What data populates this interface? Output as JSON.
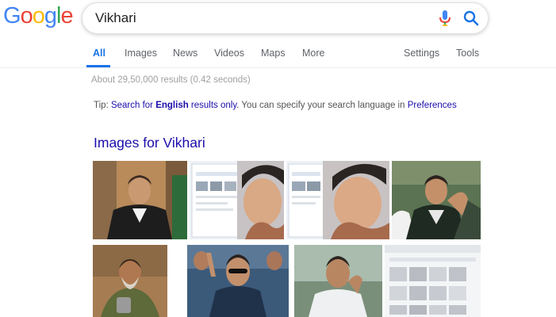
{
  "logo": {
    "letters": [
      {
        "char": "G",
        "color": "#4285F4"
      },
      {
        "char": "o",
        "color": "#EA4335"
      },
      {
        "char": "o",
        "color": "#FBBC05"
      },
      {
        "char": "g",
        "color": "#4285F4"
      },
      {
        "char": "l",
        "color": "#34A853"
      },
      {
        "char": "e",
        "color": "#EA4335"
      }
    ]
  },
  "search": {
    "query": "Vikhari",
    "mic_icon": "mic-icon",
    "search_icon": "search-icon"
  },
  "tabs": {
    "items": [
      "All",
      "Images",
      "News",
      "Videos",
      "Maps",
      "More"
    ],
    "right": [
      "Settings",
      "Tools"
    ],
    "active": "All"
  },
  "results": {
    "stats": "About 29,50,000 results (0.42 seconds)"
  },
  "tip": {
    "prefix": "Tip: ",
    "link_before": "Search for ",
    "link_bold": "English",
    "link_after": " results only",
    "middle": ". You can specify your search language in ",
    "pref_link": "Preferences"
  },
  "images_section": {
    "heading": "Images for Vikhari"
  },
  "colors": {
    "accent": "#1a73e8",
    "link": "#1a0dab",
    "muted": "#5f6368"
  }
}
